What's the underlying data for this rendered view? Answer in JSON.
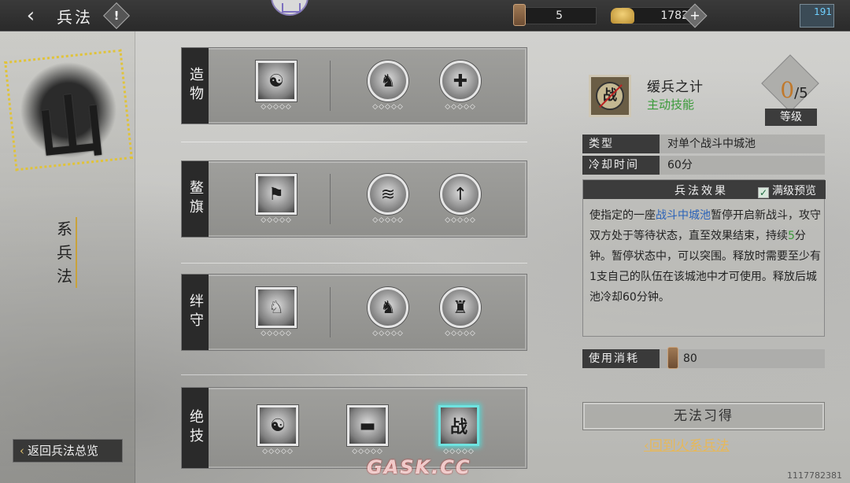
{
  "header": {
    "title": "兵法",
    "help_label": "!",
    "resource1_value": "5",
    "resource2_value": "1782",
    "plus_label": "+",
    "mail_count": "191"
  },
  "left": {
    "seal_char": "山",
    "series_name": "系兵法",
    "back_overview_label": "返回兵法总览"
  },
  "rows": [
    {
      "label": "造物",
      "skills": [
        {
          "glyph": "☯",
          "pips": "◇◇◇◇◇"
        },
        {
          "glyph": "♞",
          "pips": "◇◇◇◇◇"
        },
        {
          "glyph": "✚",
          "pips": "◇◇◇◇◇"
        }
      ]
    },
    {
      "label": "鳌旗",
      "skills": [
        {
          "glyph": "⚑",
          "pips": "◇◇◇◇◇"
        },
        {
          "glyph": "≋",
          "pips": "◇◇◇◇◇"
        },
        {
          "glyph": "↑",
          "pips": "◇◇◇◇◇"
        }
      ]
    },
    {
      "label": "绊守",
      "skills": [
        {
          "glyph": "♘",
          "pips": "◇◇◇◇◇"
        },
        {
          "glyph": "♞",
          "pips": "◇◇◇◇◇"
        },
        {
          "glyph": "♜",
          "pips": "◇◇◇◇◇"
        }
      ]
    },
    {
      "label": "绝技",
      "skills": [
        {
          "glyph": "☯",
          "pips": "◇◇◇◇◇"
        },
        {
          "glyph": "▬",
          "pips": "◇◇◇◇◇"
        },
        {
          "glyph": "战",
          "pips": "◇◇◇◇◇"
        }
      ]
    }
  ],
  "detail": {
    "icon_char": "战",
    "name": "缓兵之计",
    "skill_type": "主动技能",
    "level_current": "0",
    "level_max": "/5",
    "level_label": "等级",
    "type_key": "类型",
    "type_value": "对单个战斗中城池",
    "cooldown_key": "冷却时间",
    "cooldown_value": "60分",
    "effect_title": "兵法效果",
    "max_preview_label": "满级预览",
    "effect_part1": "使指定的一座",
    "effect_highlight": "战斗中城池",
    "effect_part2": "暂停开启新战斗，攻守双方处于等待状态，直至效果结束，持续",
    "effect_number": "5",
    "effect_part3": "分钟。暂停状态中，可以突围。释放时需要至少有1支自己的队伍在该城池中才可使用。释放后城池冷却60分钟。",
    "cost_key": "使用消耗",
    "cost_value": "80",
    "learn_label": "无法习得",
    "back_fire_label": "回到火系兵法"
  },
  "footer": {
    "watermark": "GASK.CC",
    "uid": "1117782381"
  },
  "colors": {
    "accent_gold": "#e6b85a",
    "active_green": "#3a9a3a",
    "highlight_blue": "#2a62b8",
    "selected_cyan": "#6fe3e0"
  }
}
